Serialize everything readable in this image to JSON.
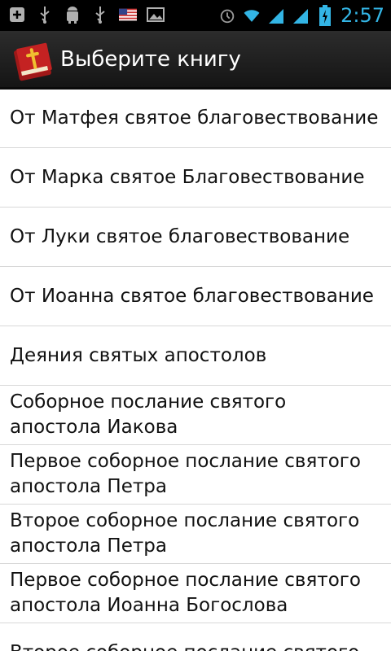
{
  "status_bar": {
    "time": "2:57",
    "left_icons": [
      "add-icon",
      "usb-icon",
      "android-debug-icon",
      "usb-icon",
      "us-flag-icon",
      "image-icon"
    ],
    "right_icons": [
      "alarm-icon",
      "wifi-icon",
      "signal-icon",
      "signal-icon",
      "battery-charging-icon"
    ],
    "accent_color": "#33b5e5"
  },
  "action_bar": {
    "title": "Выберите книгу",
    "icon": "bible-book-icon"
  },
  "books": [
    {
      "label": "От Матфея святое благовествование"
    },
    {
      "label": "От Марка святое Благовествование"
    },
    {
      "label": "От Луки святое благовествование"
    },
    {
      "label": "От Иоанна святое благовествование"
    },
    {
      "label": "Деяния святых апостолов"
    },
    {
      "label": "Соборное послание святого апостола Иакова"
    },
    {
      "label": "Первое соборное послание святого апостола Петра"
    },
    {
      "label": "Второе соборное послание святого апостола Петра"
    },
    {
      "label": "Первое соборное послание святого апостола Иоанна Богослова"
    },
    {
      "label": "Второе соборное послание святого"
    }
  ]
}
